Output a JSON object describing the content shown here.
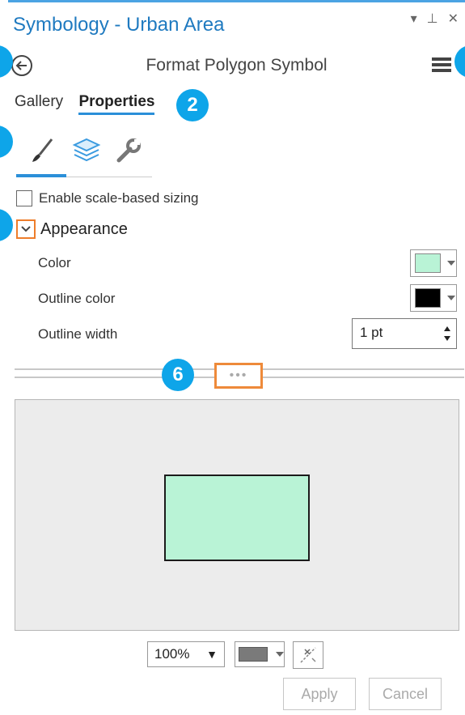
{
  "window": {
    "title": "Symbology - Urban Area",
    "pin_glyph": "⊥",
    "close_glyph": "✕"
  },
  "header": {
    "title": "Format Polygon Symbol"
  },
  "tabs": [
    {
      "label": "Gallery",
      "active": false
    },
    {
      "label": "Properties",
      "active": true
    }
  ],
  "callouts": {
    "two": "2",
    "six": "6"
  },
  "options": {
    "scale_based": "Enable scale-based sizing"
  },
  "appearance": {
    "heading": "Appearance",
    "color_label": "Color",
    "color_value": "#b9f3d6",
    "outline_color_label": "Outline color",
    "outline_color_value": "#000000",
    "outline_width_label": "Outline width",
    "outline_width_value": "1 pt"
  },
  "preview": {
    "fill": "#b9f3d6",
    "outline": "#1b1b1b",
    "background": "#ececec"
  },
  "footer": {
    "zoom": "100%",
    "apply": "Apply",
    "cancel": "Cancel"
  },
  "colors": {
    "accent": "#2b8fd8",
    "highlight": "#ee7d2b",
    "callout": "#0ea5e9"
  }
}
